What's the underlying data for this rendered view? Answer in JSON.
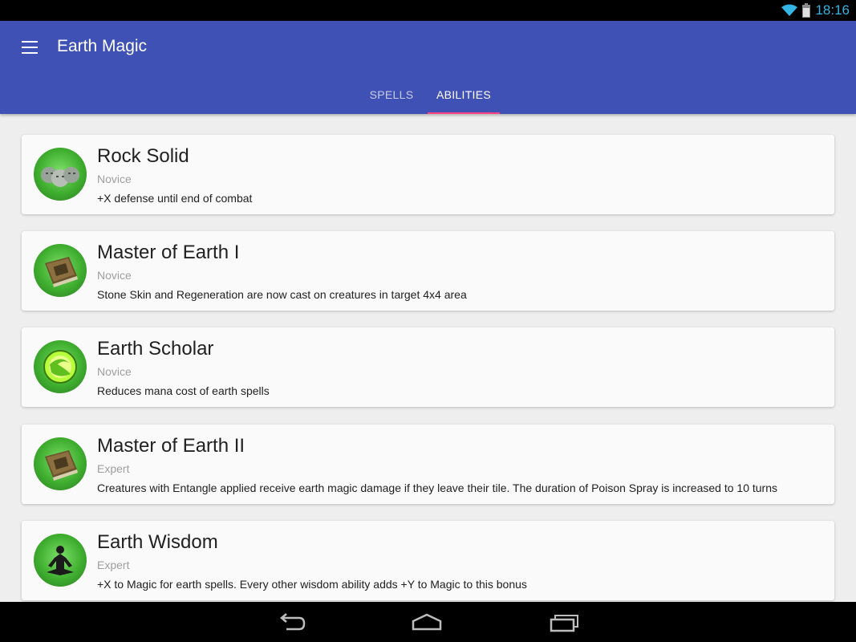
{
  "status": {
    "time": "18:16"
  },
  "app": {
    "title": "Earth Magic"
  },
  "tabs": [
    {
      "label": "SPELLS",
      "selected": false
    },
    {
      "label": "ABILITIES",
      "selected": true
    }
  ],
  "colors": {
    "primary": "#3f51b5",
    "accent": "#ff4081",
    "status_icon": "#33b5e5"
  },
  "abilities": [
    {
      "title": "Rock Solid",
      "level": "Novice",
      "description": "+X defense until end of combat",
      "icon": "stone-faces-icon"
    },
    {
      "title": "Master of Earth I",
      "level": "Novice",
      "description": "Stone Skin and Regeneration are now cast on creatures in target 4x4 area",
      "icon": "spellbook-icon"
    },
    {
      "title": "Earth Scholar",
      "level": "Novice",
      "description": "Reduces mana cost of earth spells",
      "icon": "earth-orb-icon"
    },
    {
      "title": "Master of Earth II",
      "level": "Expert",
      "description": "Creatures with Entangle applied receive earth magic damage if they leave their tile. The duration of Poison Spray is increased to 10 turns",
      "icon": "spellbook-icon"
    },
    {
      "title": "Earth Wisdom",
      "level": "Expert",
      "description": "+X to Magic for earth spells. Every other wisdom ability adds +Y to Magic to this bonus",
      "icon": "meditation-icon"
    }
  ],
  "nav": {
    "back": "back-icon",
    "home": "home-icon",
    "recents": "recents-icon"
  }
}
